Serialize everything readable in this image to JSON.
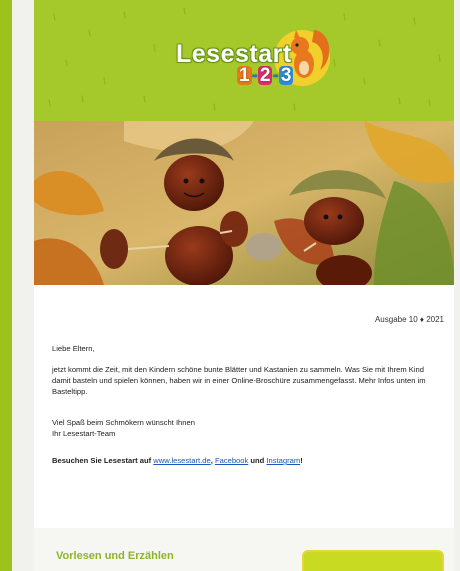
{
  "logo": {
    "word": "Lesestart",
    "digits": [
      "1",
      "-",
      "2",
      "-",
      "3"
    ]
  },
  "colors": {
    "header_green": "#a5c92a",
    "accent_green": "#8eb52a",
    "link_blue": "#1a57b8",
    "button_yellow": "#c8da22"
  },
  "hero_image": {
    "icon": "chestnut-figures-photo"
  },
  "issue_label": "Ausgabe 10 ♦ 2021",
  "greeting": "Liebe Eltern,",
  "intro": "jetzt kommt die Zeit, mit den Kindern schöne bunte Blätter und Kastanien zu sammeln. Was Sie mit Ihrem Kind damit basteln und spielen können, haben wir in einer Online-Broschüre zusammengefasst. Mehr Infos unten im Basteltipp.",
  "closing_line1": "Viel Spaß beim Schmökern wünscht Ihnen",
  "closing_line2": "Ihr Lesestart-Team",
  "visit": {
    "prefix": "Besuchen Sie Lesestart auf ",
    "link1": "www.lesestart.de",
    "sep1": ", ",
    "link2": "Facebook",
    "sep2": " und ",
    "link3": "Instagram",
    "suffix": "!"
  },
  "section": {
    "title": "Vorlesen und Erzählen"
  }
}
